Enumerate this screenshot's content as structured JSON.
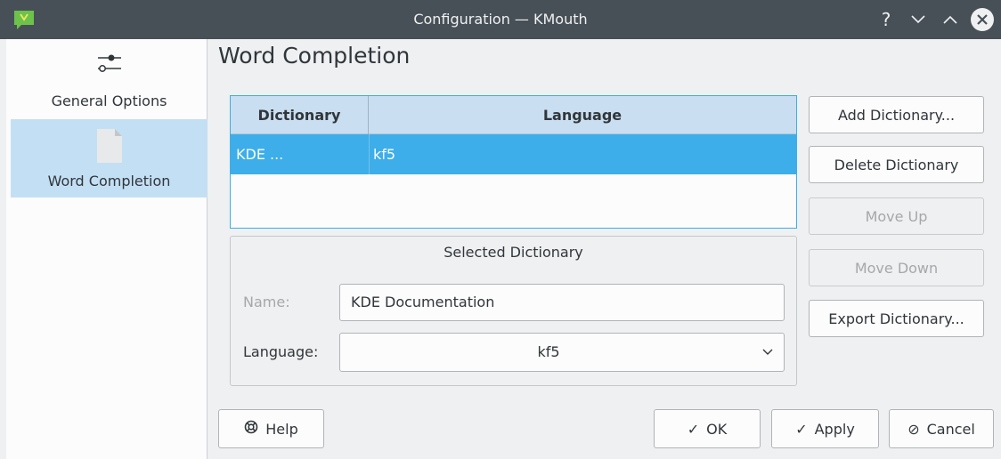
{
  "window": {
    "title": "Configuration — KMouth",
    "help_glyph": "?",
    "minimize_glyph": "⌄",
    "maximize_glyph": "⌃",
    "close_glyph": "✕",
    "app_icon": "kmouth-app-icon"
  },
  "sidebar": {
    "items": [
      {
        "label": "General Options",
        "icon": "sliders-icon",
        "active": false
      },
      {
        "label": "Word Completion",
        "icon": "document-icon",
        "active": true
      }
    ]
  },
  "page": {
    "title": "Word Completion"
  },
  "dictionary_table": {
    "columns": [
      "Dictionary",
      "Language"
    ],
    "rows": [
      {
        "dictionary": "KDE ...",
        "language": "kf5",
        "selected": true
      }
    ]
  },
  "actions": {
    "add": "Add Dictionary...",
    "delete": "Delete Dictionary",
    "move_up": "Move Up",
    "move_down": "Move Down",
    "export": "Export Dictionary..."
  },
  "selected_dictionary": {
    "group_title": "Selected Dictionary",
    "name_label": "Name:",
    "name_value": "KDE Documentation",
    "language_label": "Language:",
    "language_value": "kf5"
  },
  "footer": {
    "help": "Help",
    "ok": "OK",
    "apply": "Apply",
    "cancel": "Cancel",
    "ok_glyph": "✓",
    "apply_glyph": "✓",
    "cancel_glyph": "⊘"
  },
  "colors": {
    "titlebar": "#475057",
    "selection": "#3daee9",
    "sidebar_active": "#c3dff4",
    "header": "#c9def0"
  }
}
